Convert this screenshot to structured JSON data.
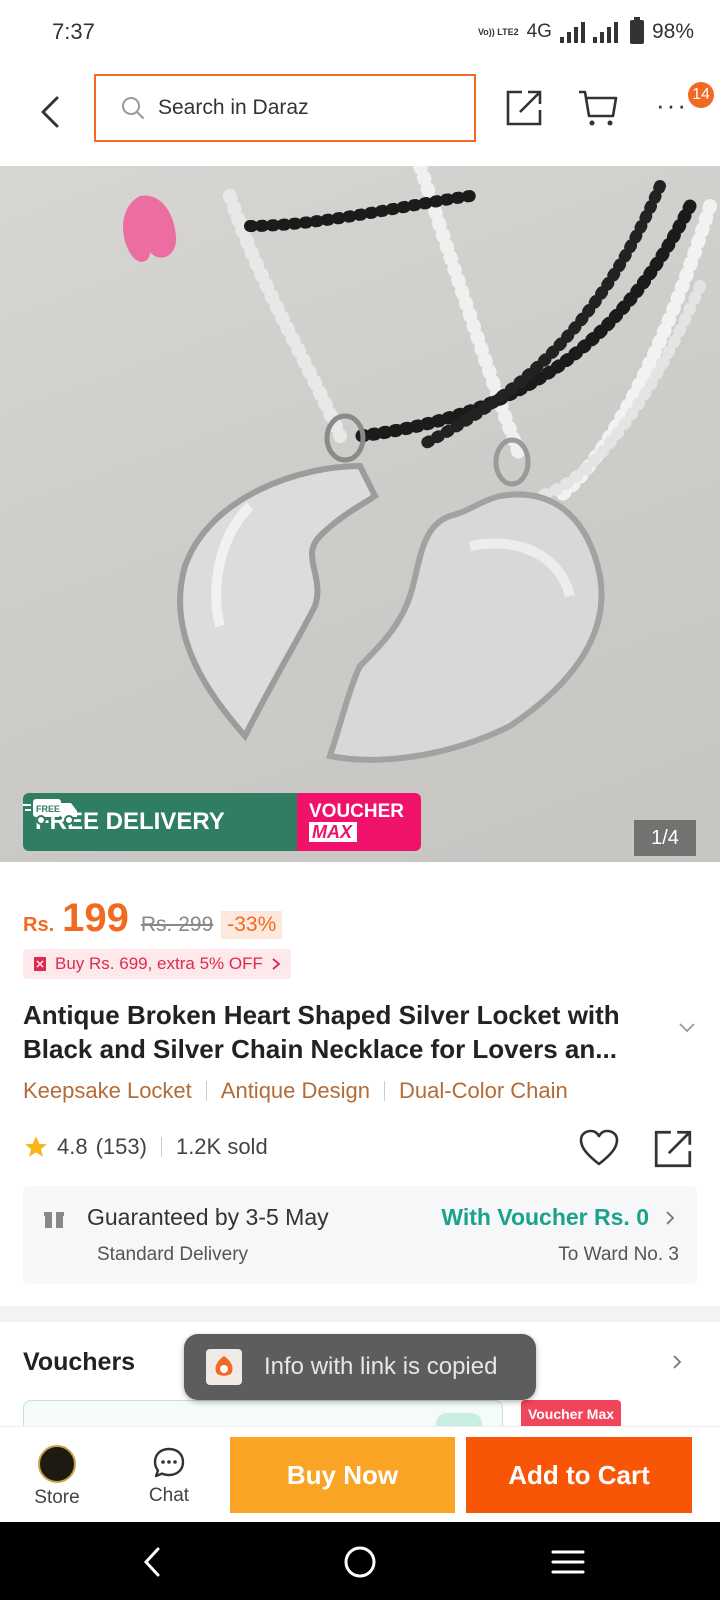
{
  "status_bar": {
    "time": "7:37",
    "network_badge": "Vo)) LTE2",
    "network": "4G",
    "battery_pct": "98%"
  },
  "header": {
    "search_placeholder": "Search in Daraz",
    "cart_badge": "14"
  },
  "gallery": {
    "image_subject": "silver broken heart locket pair",
    "promo_free_label": "FREE DELIVERY",
    "promo_free_small": "FREE",
    "promo_voucher_line1": "VOUCHER",
    "promo_voucher_line2": "MAX",
    "counter": "1/4"
  },
  "price": {
    "currency": "Rs.",
    "current": "199",
    "original": "Rs. 299",
    "discount": "-33%"
  },
  "offer": {
    "label": "Buy Rs. 699, extra 5% OFF"
  },
  "product": {
    "title": "Antique Broken Heart Shaped Silver Locket with Black and Silver Chain Necklace for Lovers an..."
  },
  "tags": [
    "Keepsake Locket",
    "Antique Design",
    "Dual-Color Chain"
  ],
  "rating": {
    "score": "4.8",
    "count": "(153)",
    "sold": "1.2K sold"
  },
  "delivery": {
    "guarantee": "Guaranteed by 3-5 May",
    "method": "Standard Delivery",
    "voucher": "With Voucher Rs. 0",
    "destination": "To Ward No. 3"
  },
  "vouchers": {
    "title": "Vouchers",
    "max_tag": "Voucher Max"
  },
  "toast": {
    "text": "Info with link is copied"
  },
  "bottom_bar": {
    "store_label": "Store",
    "chat_label": "Chat",
    "buy_now": "Buy Now",
    "add_to_cart": "Add to Cart"
  },
  "colors": {
    "accent": "#f26a21",
    "buy_now": "#faa425",
    "add_to_cart": "#f85606",
    "free_delivery": "#2f7d62",
    "voucher_max": "#f0126a",
    "teal_text": "#1aa38a"
  }
}
